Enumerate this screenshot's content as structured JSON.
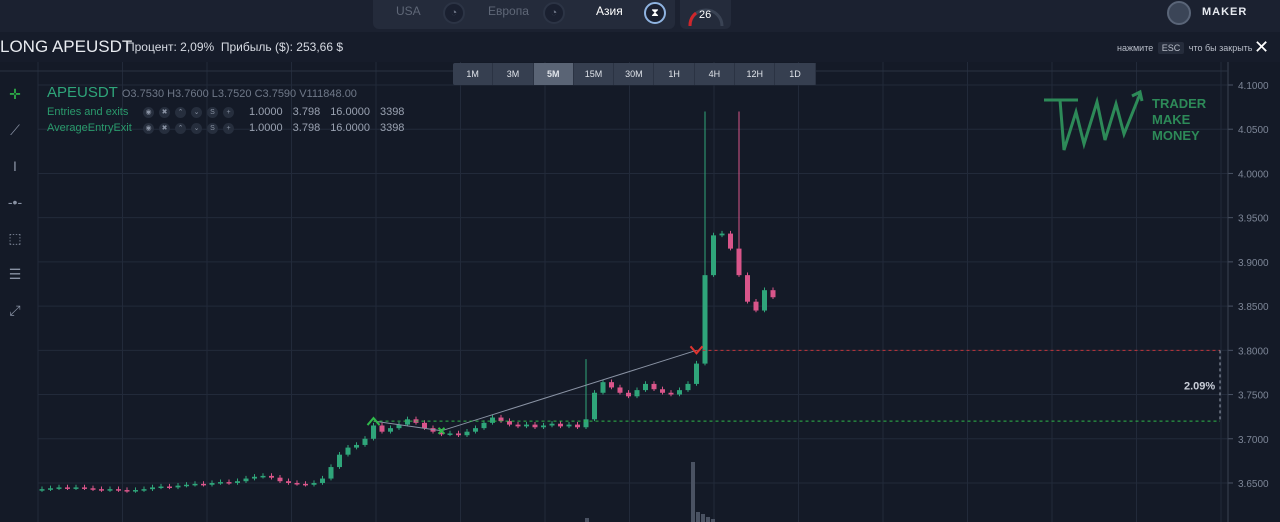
{
  "topbar": {
    "markets": [
      {
        "label": "USA",
        "active": false
      },
      {
        "label": "Европа",
        "active": false
      },
      {
        "label": "Азия",
        "active": true
      }
    ],
    "gauge_value": "26",
    "username": "MAKER"
  },
  "infobar": {
    "title": "LONG APEUSDT",
    "percent": "Процент: 2,09%",
    "profit": "Прибыль ($): 253,66 $",
    "esc_prefix": "нажмите",
    "esc_key": "ESC",
    "esc_suffix": "что бы закрыть"
  },
  "timeframes": [
    {
      "label": "1M"
    },
    {
      "label": "3M"
    },
    {
      "label": "5M",
      "active": true
    },
    {
      "label": "15M"
    },
    {
      "label": "30M"
    },
    {
      "label": "1H"
    },
    {
      "label": "4H"
    },
    {
      "label": "12H"
    },
    {
      "label": "1D"
    }
  ],
  "legend": {
    "symbol": "APEUSDT",
    "ohlc": "O3.7530 H3.7600 L3.7520 C3.7590 V111848.00",
    "indicators": [
      {
        "name": "Entries and exits",
        "values": [
          "1.0000",
          "3.798",
          "16.0000",
          "3398"
        ]
      },
      {
        "name": "AverageEntryExit",
        "values": [
          "1.0000",
          "3.798",
          "16.0000",
          "3398"
        ]
      }
    ]
  },
  "logo": {
    "line1": "TRADER",
    "line2": "MAKE",
    "line3": "MONEY"
  },
  "colors": {
    "up": "#2fa57a",
    "down": "#d9558a",
    "entry": "#2fb84a",
    "exit": "#e0342f"
  },
  "chart_data": {
    "type": "candlestick",
    "symbol": "APEUSDT",
    "timeframe": "5M",
    "y_ticks": [
      "4.1000",
      "4.0500",
      "4.0000",
      "3.9500",
      "3.9000",
      "3.8500",
      "3.8000",
      "3.7500",
      "3.7000",
      "3.6500"
    ],
    "ylim": [
      3.612,
      4.125
    ],
    "closes": [
      3.643,
      3.644,
      3.645,
      3.644,
      3.645,
      3.644,
      3.643,
      3.642,
      3.643,
      3.642,
      3.641,
      3.642,
      3.643,
      3.645,
      3.646,
      3.645,
      3.647,
      3.648,
      3.649,
      3.648,
      3.65,
      3.651,
      3.65,
      3.652,
      3.655,
      3.657,
      3.658,
      3.656,
      3.652,
      3.65,
      3.649,
      3.648,
      3.65,
      3.655,
      3.668,
      3.682,
      3.69,
      3.693,
      3.7,
      3.715,
      3.708,
      3.712,
      3.716,
      3.722,
      3.718,
      3.712,
      3.708,
      3.705,
      3.706,
      3.704,
      3.708,
      3.712,
      3.718,
      3.724,
      3.72,
      3.716,
      3.714,
      3.716,
      3.713,
      3.715,
      3.717,
      3.714,
      3.716,
      3.713,
      3.722,
      3.752,
      3.764,
      3.758,
      3.752,
      3.748,
      3.755,
      3.762,
      3.756,
      3.752,
      3.75,
      3.755,
      3.762,
      3.785,
      3.885,
      3.93,
      3.932,
      3.915,
      3.885,
      3.855,
      3.845,
      3.868,
      3.86
    ],
    "spike_high": 4.07,
    "entry": {
      "index": 39,
      "price": 3.72
    },
    "mid": {
      "index": 47,
      "price": 3.709
    },
    "exit": {
      "index": 77,
      "price": 3.8
    },
    "profit_label": "2.09%"
  }
}
